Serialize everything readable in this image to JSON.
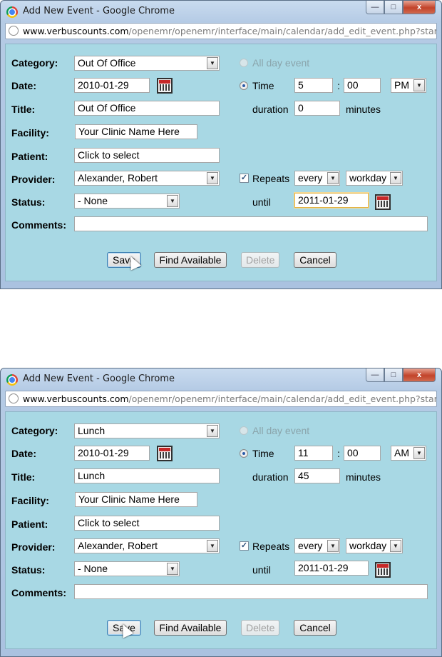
{
  "windows": [
    {
      "title": "Add New Event - Google Chrome",
      "window_controls": {
        "minimize": "—",
        "maximize": "□",
        "close": "x"
      },
      "url_host": "www.verbuscounts.com",
      "url_path": "/openemr/openemr/interface/main/calendar/add_edit_event.php?startam",
      "labels": {
        "category": "Category:",
        "date": "Date:",
        "title": "Title:",
        "facility": "Facility:",
        "patient": "Patient:",
        "provider": "Provider:",
        "status": "Status:",
        "comments": "Comments:",
        "all_day": "All day event",
        "time": "Time",
        "time_sep": ":",
        "duration": "duration",
        "minutes": "minutes",
        "repeats": "Repeats",
        "until": "until"
      },
      "category": "Out Of Office",
      "date": "2010-01-29",
      "title_value": "Out Of Office",
      "facility": "Your Clinic Name Here",
      "patient": "Click to select",
      "provider": "Alexander, Robert",
      "status": "- None",
      "comments": "",
      "time_hour": "5",
      "time_minute": "00",
      "ampm": "PM",
      "duration": "0",
      "repeat_every": "every",
      "repeat_unit": "workday",
      "until": "2011-01-29",
      "repeats_checked": "✓",
      "buttons": {
        "save": "Save",
        "find": "Find Available",
        "delete": "Delete",
        "cancel": "Cancel"
      }
    },
    {
      "title": "Add New Event - Google Chrome",
      "window_controls": {
        "minimize": "—",
        "maximize": "□",
        "close": "x"
      },
      "url_host": "www.verbuscounts.com",
      "url_path": "/openemr/openemr/interface/main/calendar/add_edit_event.php?startam",
      "labels": {
        "category": "Category:",
        "date": "Date:",
        "title": "Title:",
        "facility": "Facility:",
        "patient": "Patient:",
        "provider": "Provider:",
        "status": "Status:",
        "comments": "Comments:",
        "all_day": "All day event",
        "time": "Time",
        "time_sep": ":",
        "duration": "duration",
        "minutes": "minutes",
        "repeats": "Repeats",
        "until": "until"
      },
      "category": "Lunch",
      "date": "2010-01-29",
      "title_value": "Lunch",
      "facility": "Your Clinic Name Here",
      "patient": "Click to select",
      "provider": "Alexander, Robert",
      "status": "- None",
      "comments": "",
      "time_hour": "11",
      "time_minute": "00",
      "ampm": "AM",
      "duration": "45",
      "repeat_every": "every",
      "repeat_unit": "workday",
      "until": "2011-01-29",
      "repeats_checked": "✓",
      "buttons": {
        "save": "Save",
        "find": "Find Available",
        "delete": "Delete",
        "cancel": "Cancel"
      }
    }
  ]
}
